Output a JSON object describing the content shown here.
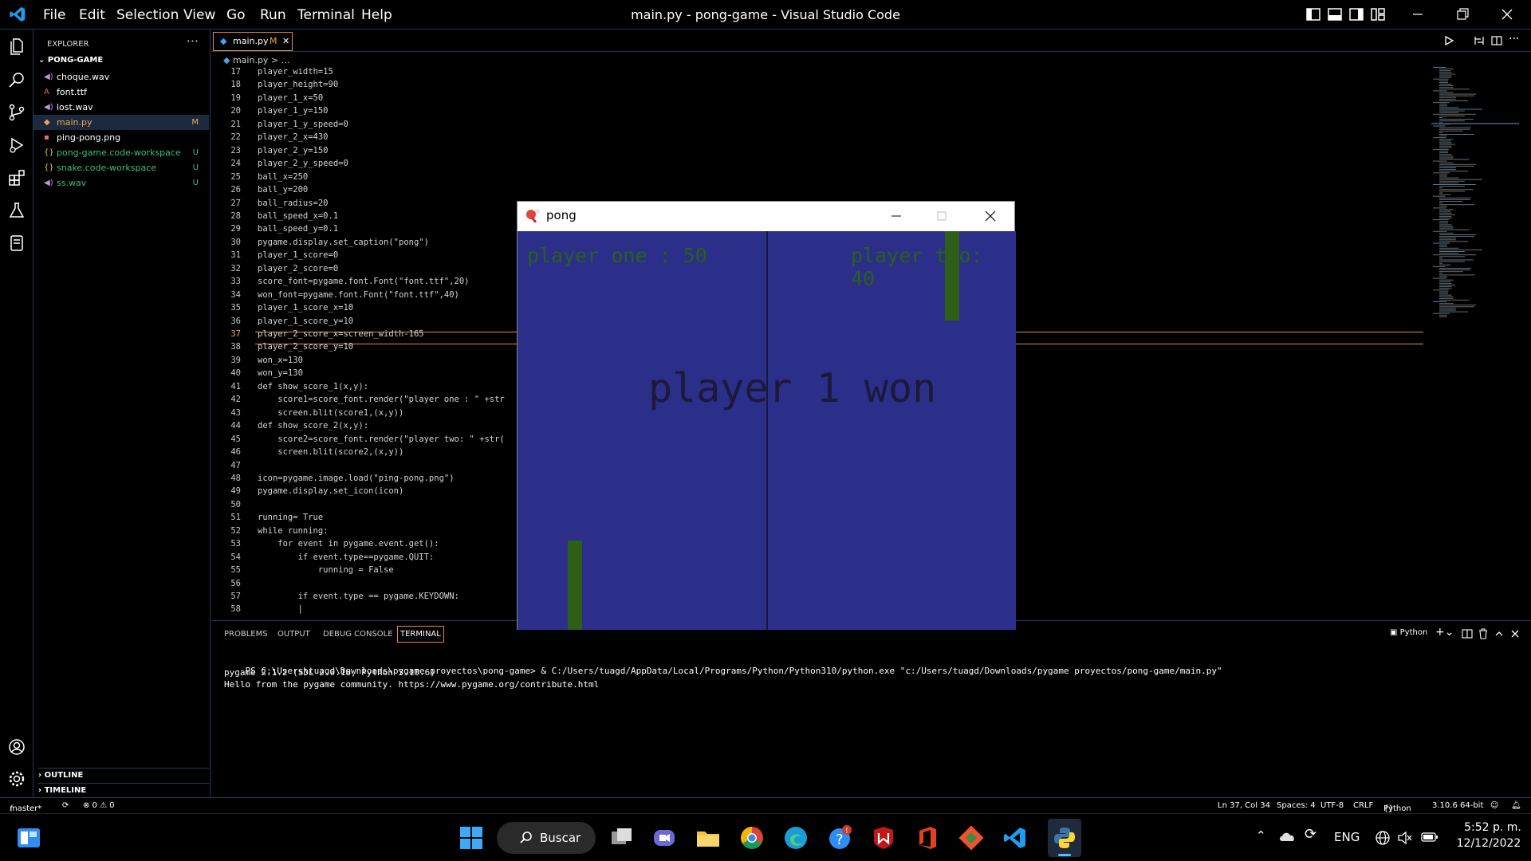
{
  "window": {
    "title": "main.py - pong-game - Visual Studio Code",
    "menu": [
      "File",
      "Edit",
      "Selection",
      "View",
      "Go",
      "Run",
      "Terminal",
      "Help"
    ]
  },
  "sidebar": {
    "header": "EXPLORER",
    "more": "···",
    "folder": "PONG-GAME",
    "files": [
      {
        "name": "choque.wav",
        "icon": "audio-file-icon",
        "color": "#c792ea",
        "badge": ""
      },
      {
        "name": "font.ttf",
        "icon": "font-file-icon",
        "color": "#e06c60",
        "badge": ""
      },
      {
        "name": "lost.wav",
        "icon": "audio-file-icon",
        "color": "#c792ea",
        "badge": ""
      },
      {
        "name": "main.py",
        "icon": "python-file-icon",
        "color": "#f0a64a",
        "badge": "M"
      },
      {
        "name": "ping-pong.png",
        "icon": "image-file-icon",
        "color": "#ffffff",
        "badge": ""
      },
      {
        "name": "pong-game.code-workspace",
        "icon": "workspace-file-icon",
        "color": "#3fbf7f",
        "badge": "U"
      },
      {
        "name": "snake.code-workspace",
        "icon": "workspace-file-icon",
        "color": "#3fbf7f",
        "badge": "U"
      },
      {
        "name": "ss.wav",
        "icon": "audio-file-icon",
        "color": "#3fbf7f",
        "badge": "U"
      }
    ],
    "outline": "OUTLINE",
    "timeline": "TIMELINE"
  },
  "editor": {
    "tab_label": "main.py",
    "tab_badge": "M",
    "breadcrumb": "main.py > ...",
    "current_line": "37",
    "lines": [
      {
        "n": "17",
        "t": "player_width=15"
      },
      {
        "n": "18",
        "t": "player_height=90"
      },
      {
        "n": "19",
        "t": "player_1_x=50"
      },
      {
        "n": "20",
        "t": "player_1_y=150"
      },
      {
        "n": "21",
        "t": "player_1_y_speed=0"
      },
      {
        "n": "22",
        "t": "player_2_x=430"
      },
      {
        "n": "23",
        "t": "player_2_y=150"
      },
      {
        "n": "24",
        "t": "player_2_y_speed=0"
      },
      {
        "n": "25",
        "t": "ball_x=250"
      },
      {
        "n": "26",
        "t": "ball_y=200"
      },
      {
        "n": "27",
        "t": "ball_radius=20"
      },
      {
        "n": "28",
        "t": "ball_speed_x=0.1"
      },
      {
        "n": "29",
        "t": "ball_speed_y=0.1"
      },
      {
        "n": "30",
        "t": "pygame.display.set_caption(\"pong\")"
      },
      {
        "n": "31",
        "t": "player_1_score=0"
      },
      {
        "n": "32",
        "t": "player_2_score=0"
      },
      {
        "n": "33",
        "t": "score_font=pygame.font.Font(\"font.ttf\",20)"
      },
      {
        "n": "34",
        "t": "won_font=pygame.font.Font(\"font.ttf\",40)"
      },
      {
        "n": "35",
        "t": "player_1_score_x=10"
      },
      {
        "n": "36",
        "t": "player_1_score_y=10"
      },
      {
        "n": "37",
        "t": "player_2_score_x=screen_width-165"
      },
      {
        "n": "38",
        "t": "player_2_score_y=10"
      },
      {
        "n": "39",
        "t": "won_x=130"
      },
      {
        "n": "40",
        "t": "won_y=130"
      },
      {
        "n": "41",
        "t": "def show_score_1(x,y):"
      },
      {
        "n": "42",
        "t": "    score1=score_font.render(\"player one : \" +str"
      },
      {
        "n": "43",
        "t": "    screen.blit(score1,(x,y))"
      },
      {
        "n": "44",
        "t": "def show_score_2(x,y):"
      },
      {
        "n": "45",
        "t": "    score2=score_font.render(\"player two: \" +str("
      },
      {
        "n": "46",
        "t": "    screen.blit(score2,(x,y))"
      },
      {
        "n": "47",
        "t": ""
      },
      {
        "n": "48",
        "t": "icon=pygame.image.load(\"ping-pong.png\")"
      },
      {
        "n": "49",
        "t": "pygame.display.set_icon(icon)"
      },
      {
        "n": "50",
        "t": ""
      },
      {
        "n": "51",
        "t": "running= True"
      },
      {
        "n": "52",
        "t": "while running:"
      },
      {
        "n": "53",
        "t": "    for event in pygame.event.get():"
      },
      {
        "n": "54",
        "t": "        if event.type==pygame.QUIT:"
      },
      {
        "n": "55",
        "t": "            running = False"
      },
      {
        "n": "56",
        "t": ""
      },
      {
        "n": "57",
        "t": "        if event.type == pygame.KEYDOWN:"
      },
      {
        "n": "58",
        "t": "        |"
      }
    ]
  },
  "pong_window": {
    "title": "pong",
    "score_one": "player one : 50",
    "score_two": "player two: 40",
    "won_text": "player 1 won",
    "colors": {
      "background": "#2c2f8a",
      "paddle": "#2e5e18",
      "score": "#2e5e18",
      "won": "#1a1a3a"
    }
  },
  "panel": {
    "tabs": [
      "PROBLEMS",
      "OUTPUT",
      "DEBUG CONSOLE",
      "TERMINAL"
    ],
    "active_tab": "TERMINAL",
    "shell_label": "Python",
    "terminal_lines": [
      "PS C:\\Users\\tuagd\\Downloads\\pygame proyectos\\pong-game> & C:/Users/tuagd/AppData/Local/Programs/Python/Python310/python.exe \"c:/Users/tuagd/Downloads/pygame proyectos/pong-game/main.py\"",
      "pygame 2.1.2 (SDL 2.0.18, Python 3.10.6)",
      "Hello from the pygame community. https://www.pygame.org/contribute.html"
    ]
  },
  "statusbar": {
    "branch": "master*",
    "problems": "⊗ 0 ⚠ 0",
    "position": "Ln 37, Col 34",
    "spaces": "Spaces: 4",
    "encoding": "UTF-8",
    "eol": "CRLF",
    "language": "Python",
    "interpreter": "3.10.6 64-bit"
  },
  "taskbar": {
    "search": "Buscar",
    "lang": "ENG",
    "time": "5:52 p. m.",
    "date": "12/12/2022"
  }
}
